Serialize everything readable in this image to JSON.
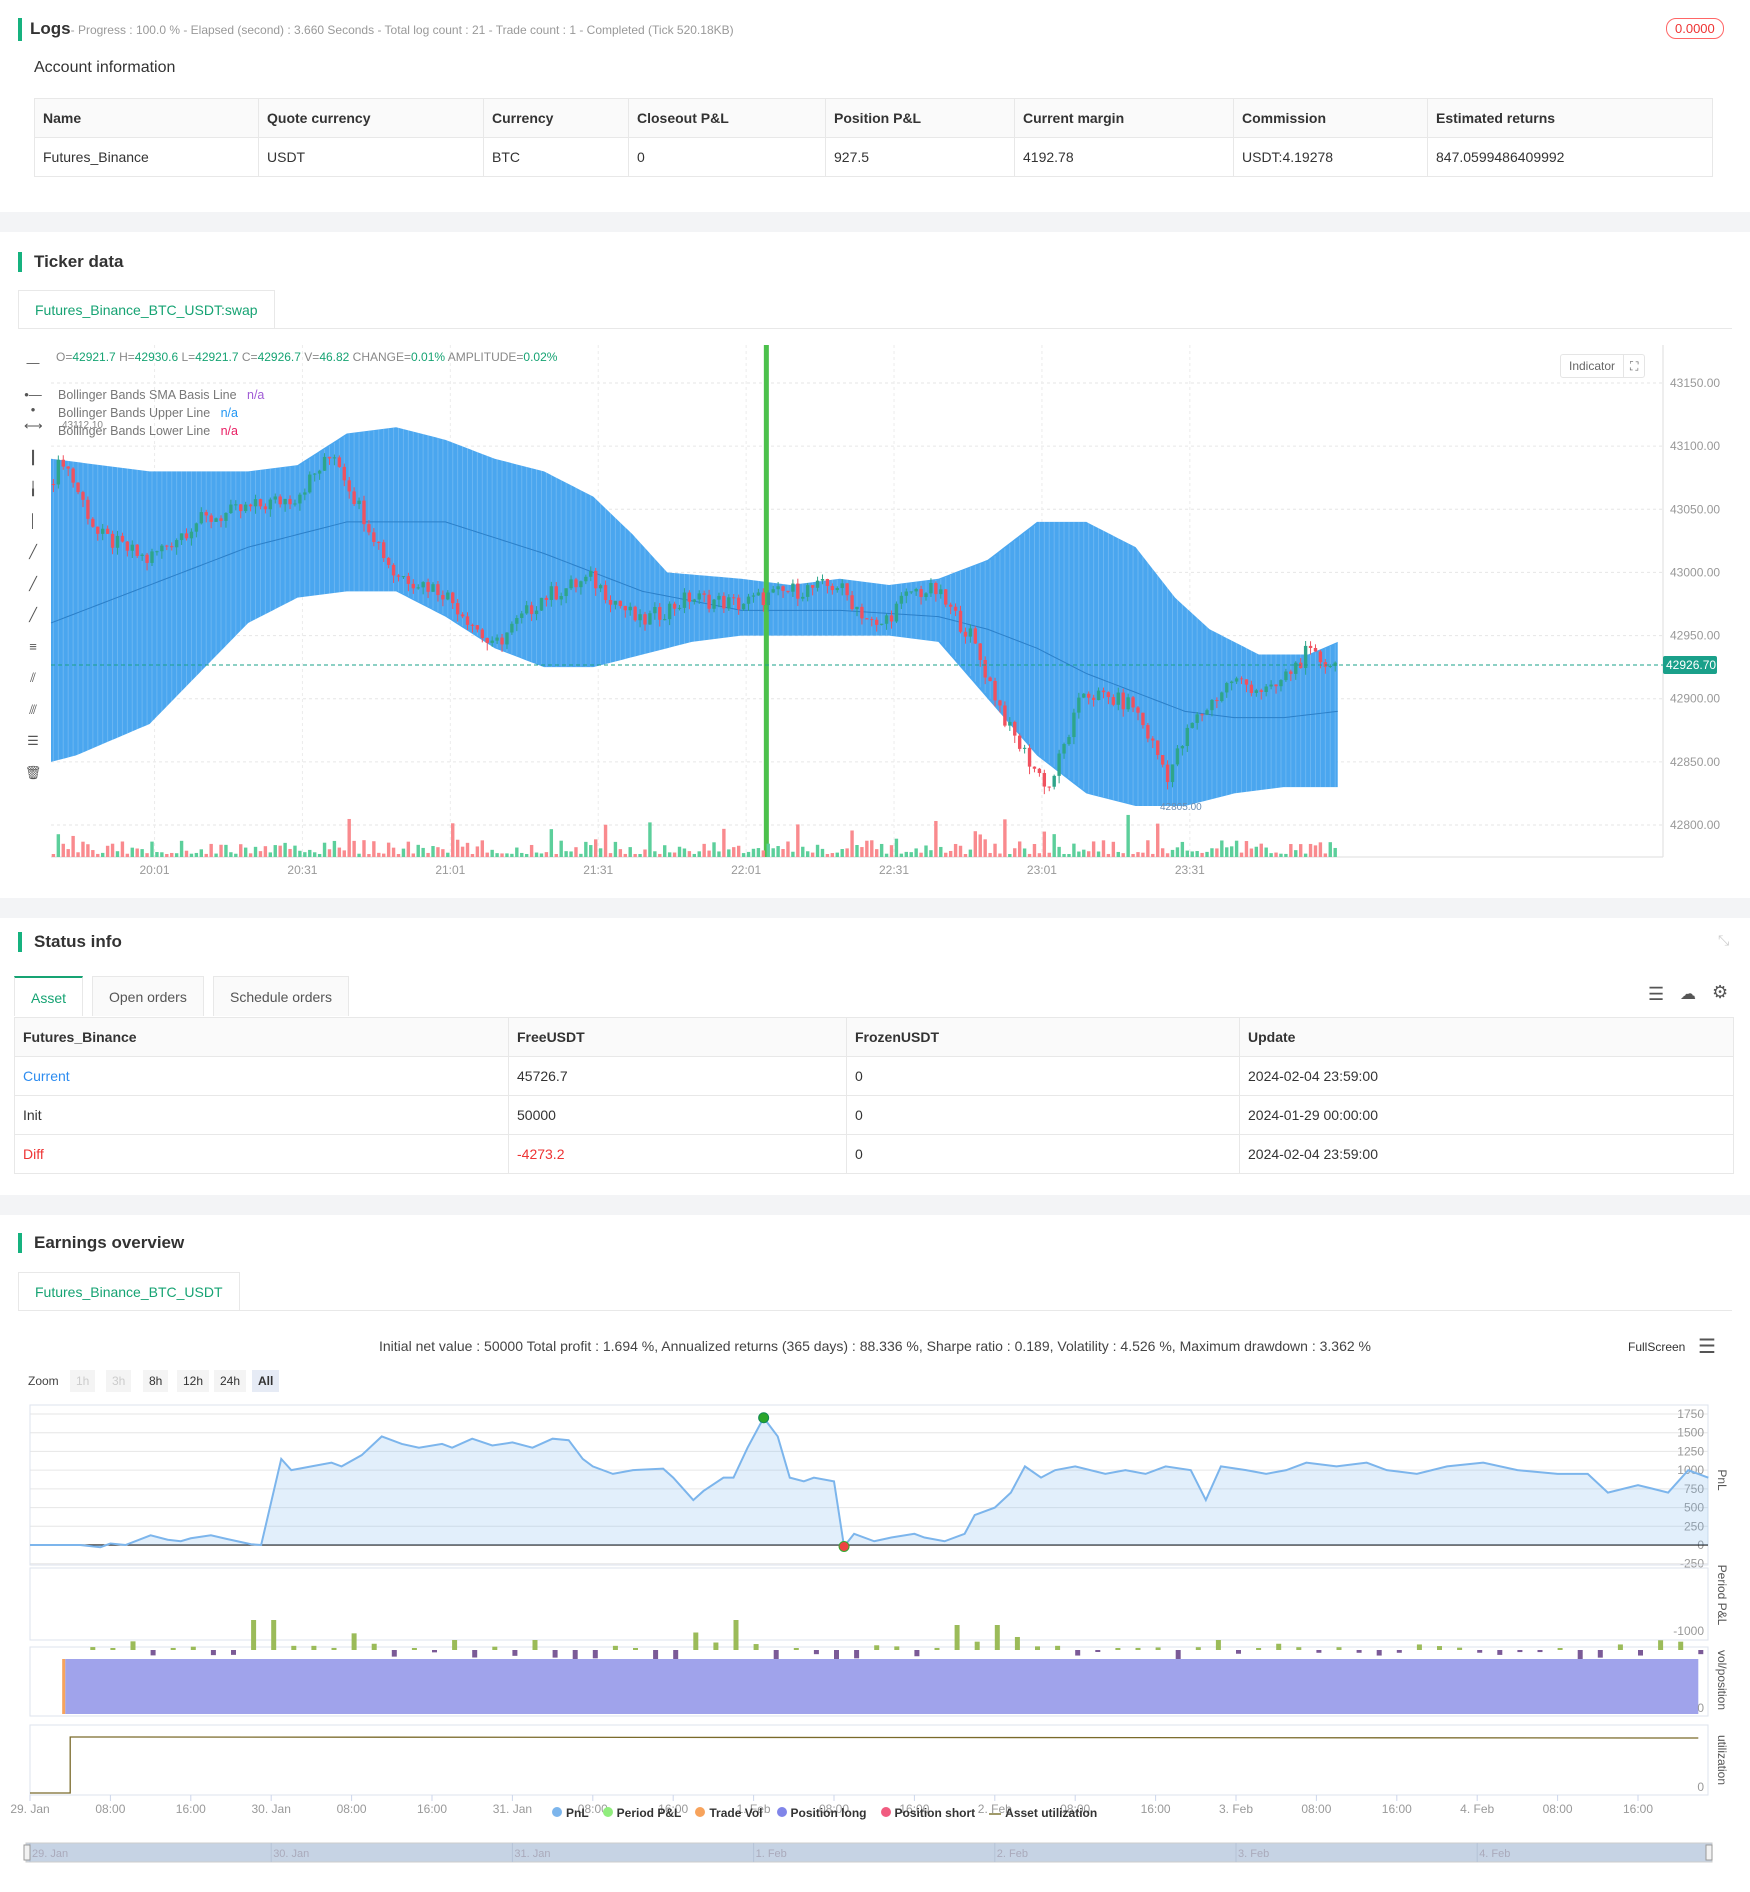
{
  "logs": {
    "title": "Logs",
    "summary": "- Progress : 100.0 % - Elapsed (second) : 3.660  Seconds - Total log count : 21 - Trade count : 1 - Completed (Tick 520.18KB)",
    "badge": "0.0000"
  },
  "account": {
    "title": "Account information",
    "headers": [
      "Name",
      "Quote currency",
      "Currency",
      "Closeout P&L",
      "Position P&L",
      "Current margin",
      "Commission",
      "Estimated returns"
    ],
    "row": [
      "Futures_Binance",
      "USDT",
      "BTC",
      "0",
      "927.5",
      "4192.78",
      "USDT:4.19278",
      "847.0599486409992"
    ]
  },
  "ticker": {
    "title": "Ticker data",
    "tab": "Futures_Binance_BTC_USDT:swap",
    "ohlc": {
      "o_label": "O=",
      "o": "42921.7",
      "h_label": " H=",
      "h": "42930.6",
      "l_label": " L=",
      "l": "42921.7",
      "c_label": " C=",
      "c": "42926.7",
      "v_label": " V=",
      "v": "46.82",
      "change_label": " CHANGE=",
      "change": "0.01%",
      "amp_label": " AMPLITUDE=",
      "amp": "0.02%"
    },
    "legend": [
      {
        "label": "Bollinger Bands SMA Basis Line",
        "value": "n/a",
        "color": "#a05bd5"
      },
      {
        "label": "Bollinger Bands Upper Line",
        "value": "n/a",
        "color": "#2196f3"
      },
      {
        "label": "Bollinger Bands Lower Line",
        "value": "n/a",
        "color": "#e91e63"
      }
    ],
    "indicator_btn": "Indicator",
    "high_mark": "43112.10",
    "low_mark": "42805.00"
  },
  "chart_data": {
    "type": "candlestick",
    "title": "Futures_Binance_BTC_USDT:swap",
    "start_time": "19:40",
    "minutes": 261,
    "ylim": [
      42775,
      43190
    ],
    "yticks": [
      "43150.00",
      "43100.00",
      "43050.00",
      "43000.00",
      "42950.00",
      "42900.00",
      "42850.00",
      "42800.00"
    ],
    "xticks": [
      {
        "t": 21,
        "label": "20:01"
      },
      {
        "t": 51,
        "label": "20:31"
      },
      {
        "t": 81,
        "label": "21:01"
      },
      {
        "t": 111,
        "label": "21:31"
      },
      {
        "t": 141,
        "label": "22:01"
      },
      {
        "t": 171,
        "label": "22:31"
      },
      {
        "t": 201,
        "label": "23:01"
      },
      {
        "t": 231,
        "label": "23:31"
      }
    ],
    "last_price": "42926.70",
    "last_value": 42926.7,
    "trade_marker_t": 145,
    "close": [
      [
        0,
        43070
      ],
      [
        3,
        43090
      ],
      [
        10,
        43030
      ],
      [
        20,
        43010
      ],
      [
        30,
        43040
      ],
      [
        40,
        43050
      ],
      [
        50,
        43060
      ],
      [
        58,
        43095
      ],
      [
        62,
        43060
      ],
      [
        70,
        43000
      ],
      [
        80,
        42985
      ],
      [
        86,
        42960
      ],
      [
        90,
        42940
      ],
      [
        100,
        42980
      ],
      [
        110,
        42995
      ],
      [
        120,
        42960
      ],
      [
        130,
        42980
      ],
      [
        140,
        42975
      ],
      [
        150,
        42985
      ],
      [
        160,
        42990
      ],
      [
        168,
        42955
      ],
      [
        175,
        42985
      ],
      [
        180,
        42985
      ],
      [
        187,
        42950
      ],
      [
        195,
        42875
      ],
      [
        200,
        42845
      ],
      [
        203,
        42830
      ],
      [
        210,
        42905
      ],
      [
        220,
        42895
      ],
      [
        227,
        42840
      ],
      [
        232,
        42880
      ],
      [
        240,
        42915
      ],
      [
        248,
        42905
      ],
      [
        255,
        42935
      ],
      [
        261,
        42927
      ]
    ],
    "upper": [
      [
        0,
        43090
      ],
      [
        20,
        43080
      ],
      [
        40,
        43080
      ],
      [
        50,
        43085
      ],
      [
        60,
        43110
      ],
      [
        70,
        43115
      ],
      [
        80,
        43105
      ],
      [
        90,
        43090
      ],
      [
        100,
        43080
      ],
      [
        110,
        43060
      ],
      [
        118,
        43030
      ],
      [
        125,
        43000
      ],
      [
        140,
        42995
      ],
      [
        150,
        42990
      ],
      [
        160,
        42995
      ],
      [
        170,
        42990
      ],
      [
        180,
        42995
      ],
      [
        190,
        43010
      ],
      [
        200,
        43040
      ],
      [
        210,
        43040
      ],
      [
        220,
        43020
      ],
      [
        228,
        42980
      ],
      [
        235,
        42955
      ],
      [
        245,
        42935
      ],
      [
        255,
        42935
      ],
      [
        261,
        42945
      ]
    ],
    "lower": [
      [
        0,
        42850
      ],
      [
        5,
        42855
      ],
      [
        20,
        42880
      ],
      [
        30,
        42920
      ],
      [
        40,
        42960
      ],
      [
        50,
        42980
      ],
      [
        60,
        42985
      ],
      [
        70,
        42985
      ],
      [
        80,
        42965
      ],
      [
        90,
        42940
      ],
      [
        100,
        42925
      ],
      [
        110,
        42925
      ],
      [
        120,
        42935
      ],
      [
        130,
        42945
      ],
      [
        140,
        42950
      ],
      [
        160,
        42950
      ],
      [
        170,
        42950
      ],
      [
        180,
        42945
      ],
      [
        190,
        42900
      ],
      [
        200,
        42855
      ],
      [
        210,
        42825
      ],
      [
        220,
        42815
      ],
      [
        230,
        42815
      ],
      [
        240,
        42825
      ],
      [
        250,
        42830
      ],
      [
        261,
        42830
      ]
    ],
    "basis": [
      [
        0,
        42960
      ],
      [
        20,
        42990
      ],
      [
        40,
        43020
      ],
      [
        60,
        43040
      ],
      [
        80,
        43040
      ],
      [
        100,
        43015
      ],
      [
        120,
        42985
      ],
      [
        140,
        42970
      ],
      [
        160,
        42970
      ],
      [
        180,
        42965
      ],
      [
        190,
        42955
      ],
      [
        200,
        42940
      ],
      [
        210,
        42920
      ],
      [
        220,
        42905
      ],
      [
        230,
        42890
      ],
      [
        240,
        42885
      ],
      [
        250,
        42885
      ],
      [
        261,
        42890
      ]
    ]
  },
  "status": {
    "title": "Status info",
    "tabs": [
      "Asset",
      "Open orders",
      "Schedule orders"
    ],
    "headers": [
      "Futures_Binance",
      "FreeUSDT",
      "FrozenUSDT",
      "Update"
    ],
    "rows": [
      {
        "name": "Current",
        "free": "45726.7",
        "frozen": "0",
        "update": "2024-02-04 23:59:00"
      },
      {
        "name": "Init",
        "free": "50000",
        "frozen": "0",
        "update": "2024-01-29 00:00:00"
      },
      {
        "name": "Diff",
        "free": "-4273.2",
        "frozen": "0",
        "update": "2024-02-04 23:59:00"
      }
    ]
  },
  "earnings": {
    "title": "Earnings overview",
    "tab": "Futures_Binance_BTC_USDT",
    "stats": "Initial net value : 50000 Total profit : 1.694 %, Annualized returns (365 days) : 88.336 %, Sharpe ratio : 0.189, Volatility : 4.526 %, Maximum drawdown : 3.362 %",
    "fullscreen": "FullScreen",
    "zoom_label": "Zoom",
    "zoom_opts": [
      "1h",
      "3h",
      "8h",
      "12h",
      "24h",
      "All"
    ],
    "axis_titles": [
      "PnL",
      "Period P&L",
      "vol/position",
      "utilization"
    ],
    "pnl_ticks": [
      "1750",
      "1500",
      "1250",
      "1000",
      "750",
      "500",
      "250",
      "0",
      "-250"
    ],
    "period_tick": "-1000",
    "vol_tick": "0",
    "util_tick": "0",
    "xticks": [
      "29. Jan",
      "08:00",
      "16:00",
      "30. Jan",
      "08:00",
      "16:00",
      "31. Jan",
      "08:00",
      "16:00",
      "1. Feb",
      "08:00",
      "16:00",
      "2. Feb",
      "08:00",
      "16:00",
      "3. Feb",
      "08:00",
      "16:00",
      "4. Feb",
      "08:00",
      "16:00"
    ],
    "nav_ticks": [
      "29. Jan",
      "30. Jan",
      "31. Jan",
      "1. Feb",
      "2. Feb",
      "3. Feb",
      "4. Feb"
    ],
    "legend": [
      {
        "label": "PnL",
        "color": "#7cb5ec"
      },
      {
        "label": "Period P&L",
        "color": "#90ed7d"
      },
      {
        "label": "Trade Vol",
        "color": "#f7a35c"
      },
      {
        "label": "Position long",
        "color": "#8085e9"
      },
      {
        "label": "Position short",
        "color": "#f15c80"
      },
      {
        "label": "Asset utilization",
        "color": "#a09a6a"
      }
    ]
  },
  "earnings_chart": {
    "type": "line",
    "x_unit": "hours since 29 Jan 00:00",
    "ylim": [
      -250,
      1750
    ],
    "pnl": [
      [
        0,
        0
      ],
      [
        5,
        0
      ],
      [
        7,
        -30
      ],
      [
        8,
        20
      ],
      [
        9.5,
        0
      ],
      [
        12,
        130
      ],
      [
        13.7,
        70
      ],
      [
        15,
        50
      ],
      [
        16,
        90
      ],
      [
        18,
        130
      ],
      [
        19.6,
        80
      ],
      [
        22,
        10
      ],
      [
        23,
        0
      ],
      [
        25,
        1150
      ],
      [
        26,
        1000
      ],
      [
        28,
        1050
      ],
      [
        30,
        1100
      ],
      [
        31,
        1050
      ],
      [
        33,
        1200
      ],
      [
        35,
        1450
      ],
      [
        37,
        1350
      ],
      [
        38.7,
        1300
      ],
      [
        41,
        1350
      ],
      [
        42,
        1300
      ],
      [
        44,
        1420
      ],
      [
        46,
        1330
      ],
      [
        48,
        1370
      ],
      [
        50,
        1300
      ],
      [
        52,
        1420
      ],
      [
        53.6,
        1400
      ],
      [
        55,
        1150
      ],
      [
        56,
        1050
      ],
      [
        58,
        950
      ],
      [
        60,
        1000
      ],
      [
        63,
        1020
      ],
      [
        64,
        900
      ],
      [
        66,
        600
      ],
      [
        67,
        720
      ],
      [
        69,
        900
      ],
      [
        70,
        900
      ],
      [
        71.4,
        1300
      ],
      [
        73,
        1700
      ],
      [
        74.4,
        1450
      ],
      [
        75.6,
        900
      ],
      [
        77,
        850
      ],
      [
        78,
        900
      ],
      [
        80,
        850
      ],
      [
        81,
        -20
      ],
      [
        82,
        150
      ],
      [
        84,
        50
      ],
      [
        85.7,
        100
      ],
      [
        88,
        150
      ],
      [
        89,
        100
      ],
      [
        91,
        50
      ],
      [
        93,
        150
      ],
      [
        94,
        400
      ],
      [
        96,
        500
      ],
      [
        97.6,
        700
      ],
      [
        99,
        1050
      ],
      [
        100.6,
        900
      ],
      [
        102,
        1000
      ],
      [
        104,
        1050
      ],
      [
        107,
        950
      ],
      [
        109,
        1000
      ],
      [
        111,
        950
      ],
      [
        113,
        1050
      ],
      [
        115.5,
        1000
      ],
      [
        117,
        600
      ],
      [
        118.5,
        1050
      ],
      [
        121,
        1000
      ],
      [
        123,
        950
      ],
      [
        125,
        1000
      ],
      [
        127,
        1100
      ],
      [
        130,
        1050
      ],
      [
        133,
        1100
      ],
      [
        135,
        1000
      ],
      [
        138,
        950
      ],
      [
        141,
        1050
      ],
      [
        144.6,
        1100
      ],
      [
        148,
        1000
      ],
      [
        152,
        950
      ],
      [
        155,
        950
      ],
      [
        157,
        700
      ],
      [
        160,
        800
      ],
      [
        163,
        700
      ],
      [
        165,
        1000
      ],
      [
        167,
        900
      ]
    ],
    "max_point_h": 73,
    "min_point_h": 81,
    "position_start_h": 3.5,
    "position_end_h": 166,
    "utilization_start_h": 4
  }
}
